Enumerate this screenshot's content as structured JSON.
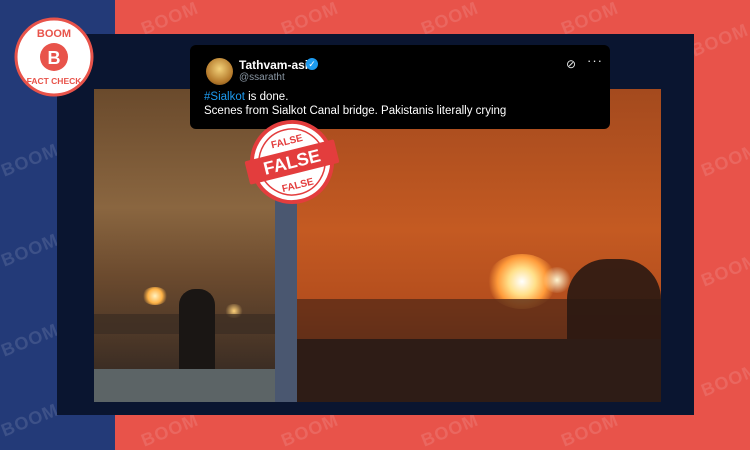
{
  "background": {
    "left_color": "#233a78",
    "right_color": "#e8534a",
    "watermark": "BOOM"
  },
  "logo": {
    "top_text": "BOOM",
    "letter": "B",
    "bottom_text": "FACT CHECK",
    "color": "#e8534a"
  },
  "tweet": {
    "author_name": "Tathvam-asi",
    "handle": "@ssaratht",
    "hashtag": "#Sialkot",
    "line1_rest": " is done.",
    "line2": "Scenes from Sialkot Canal bridge. Pakistanis literally crying",
    "icons": [
      "avatar",
      "verified-badge-icon",
      "grok-icon",
      "more-options-icon"
    ]
  },
  "stamp": {
    "label": "FALSE",
    "color": "#e33d3d"
  },
  "photos": [
    "night-fire-scene-left",
    "night-fire-scene-right"
  ]
}
